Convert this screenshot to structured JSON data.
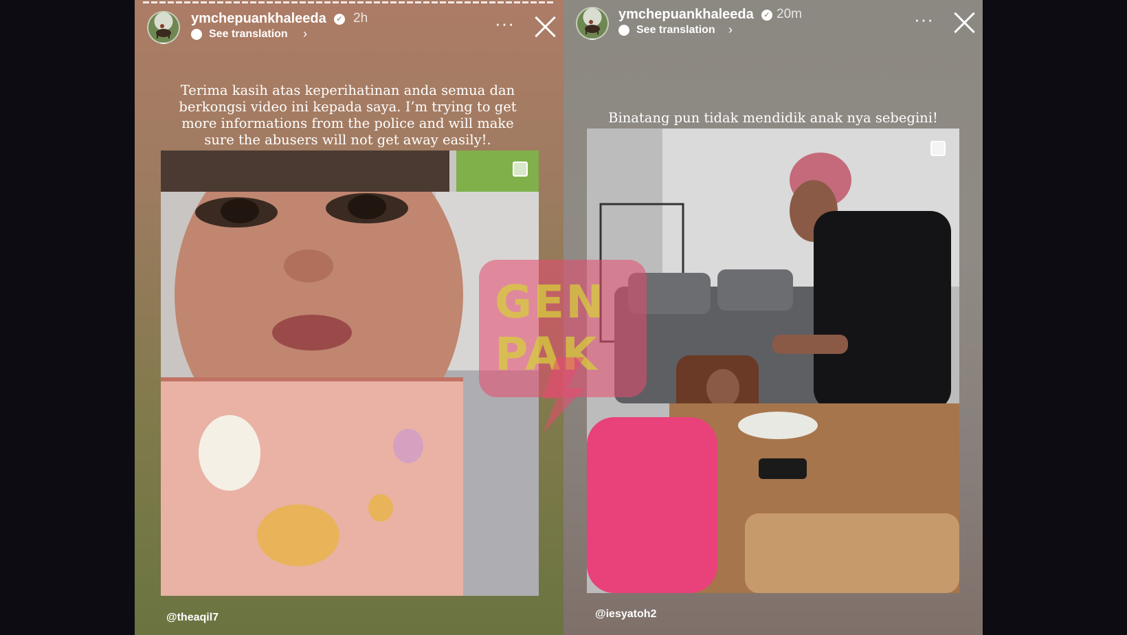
{
  "left_story": {
    "username": "ymchepuankhaleeda",
    "timestamp": "2h",
    "translate_label": "See translation",
    "caption": "Terima kasih atas keperihatinan anda semua dan berkongsi video ini kepada saya. I’m trying to get more informations from the police and will make sure the abusers will not get away easily!.",
    "media_description": "close-up photo of a young child",
    "mention": "@theaqil7"
  },
  "right_story": {
    "username": "ymchepuankhaleeda",
    "timestamp": "20m",
    "translate_label": "See translation",
    "caption": "Binatang pun tidak mendidik anak nya sebegini!",
    "media_description": "photo of a woman at a dining table with a child",
    "mention": "@iesyatoh2"
  },
  "watermark": {
    "text_line1": "GEN",
    "text_line2": "PAK"
  },
  "icons": {
    "verified": "verified-badge-icon",
    "translate": "translate-bubble-icon",
    "more": "more-options-icon",
    "close": "close-icon",
    "multi": "multi-photo-icon"
  },
  "colors": {
    "left_bg_top": "#ad7c66",
    "left_bg_bottom": "#6a7440",
    "right_bg": "#8c8882",
    "watermark_pink": "#e84a70",
    "watermark_yellow": "#d7cd3c"
  }
}
